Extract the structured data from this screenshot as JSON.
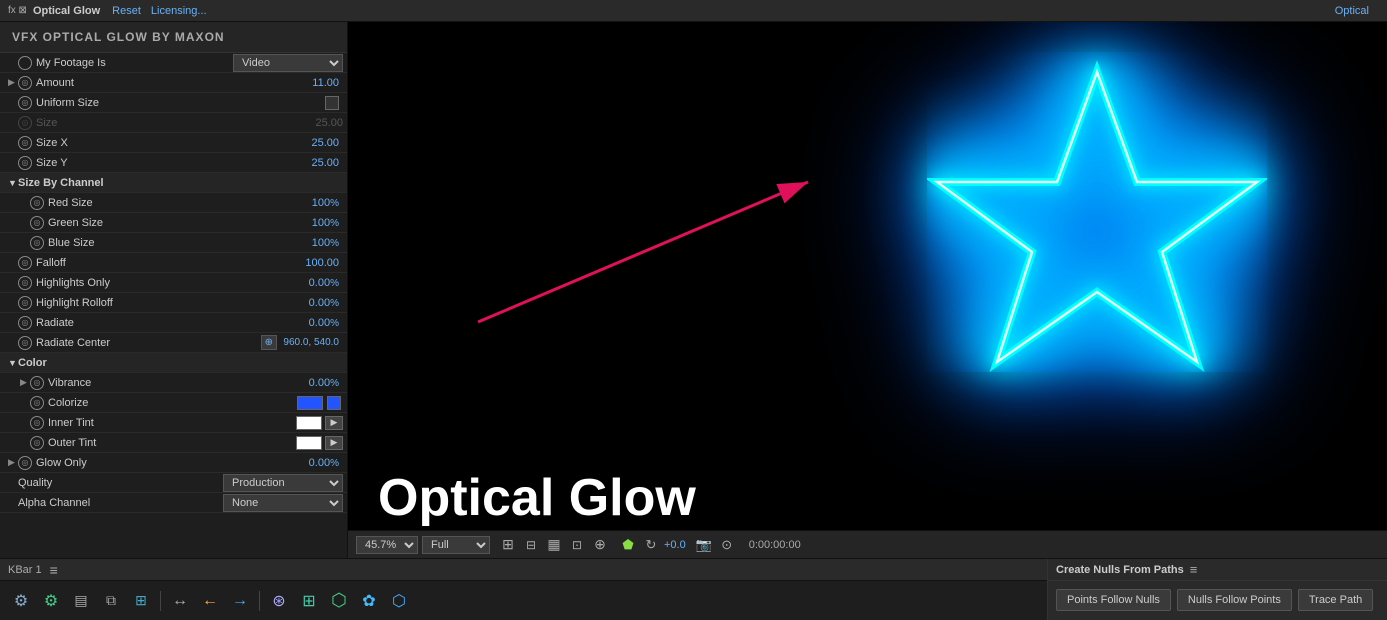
{
  "topbar": {
    "plugin_name": "Optical Glow",
    "fx_label": "fx ⊠",
    "reset_label": "Reset",
    "licensing_label": "Licensing...",
    "tab_label": "Optical"
  },
  "plugin_title": "VFX OPTICAL GLOW BY MAXON",
  "params": [
    {
      "id": "my-footage-is",
      "name": "My Footage Is",
      "type": "dropdown",
      "value": "Video",
      "expandable": false,
      "indent": 0
    },
    {
      "id": "amount",
      "name": "Amount",
      "type": "value",
      "value": "11.00",
      "expandable": true,
      "indent": 0
    },
    {
      "id": "uniform-size",
      "name": "Uniform Size",
      "type": "checkbox",
      "value": false,
      "expandable": false,
      "indent": 0
    },
    {
      "id": "size",
      "name": "Size",
      "type": "value",
      "value": "25.00",
      "disabled": true,
      "expandable": false,
      "indent": 0
    },
    {
      "id": "size-x",
      "name": "Size X",
      "type": "value",
      "value": "25.00",
      "expandable": false,
      "indent": 0
    },
    {
      "id": "size-y",
      "name": "Size Y",
      "type": "value",
      "value": "25.00",
      "expandable": false,
      "indent": 0
    },
    {
      "id": "size-by-channel",
      "name": "Size By Channel",
      "type": "group",
      "expandable": true,
      "indent": 0
    },
    {
      "id": "red-size",
      "name": "Red Size",
      "type": "value",
      "value": "100",
      "unit": "%",
      "expandable": false,
      "indent": 1
    },
    {
      "id": "green-size",
      "name": "Green Size",
      "type": "value",
      "value": "100",
      "unit": "%",
      "expandable": false,
      "indent": 1
    },
    {
      "id": "blue-size",
      "name": "Blue Size",
      "type": "value",
      "value": "100",
      "unit": "%",
      "expandable": false,
      "indent": 1
    },
    {
      "id": "falloff",
      "name": "Falloff",
      "type": "value",
      "value": "100.00",
      "expandable": false,
      "indent": 0
    },
    {
      "id": "highlights-only",
      "name": "Highlights Only",
      "type": "value",
      "value": "0.00",
      "unit": "%",
      "expandable": false,
      "indent": 0
    },
    {
      "id": "highlight-rolloff",
      "name": "Highlight Rolloff",
      "type": "value",
      "value": "0.00",
      "unit": "%",
      "expandable": false,
      "indent": 0
    },
    {
      "id": "radiate",
      "name": "Radiate",
      "type": "value",
      "value": "0.00",
      "unit": "%",
      "expandable": false,
      "indent": 0
    },
    {
      "id": "radiate-center",
      "name": "Radiate Center",
      "type": "coords",
      "value": "960.0, 540.0",
      "expandable": false,
      "indent": 0
    },
    {
      "id": "color-section",
      "name": "Color",
      "type": "section",
      "expandable": true,
      "indent": 0
    },
    {
      "id": "vibrance",
      "name": "Vibrance",
      "type": "value",
      "value": "0.00",
      "unit": "%",
      "expandable": true,
      "indent": 1
    },
    {
      "id": "colorize",
      "name": "Colorize",
      "type": "color",
      "color": "blue",
      "expandable": false,
      "indent": 1
    },
    {
      "id": "inner-tint",
      "name": "Inner Tint",
      "type": "tint",
      "expandable": false,
      "indent": 1
    },
    {
      "id": "outer-tint",
      "name": "Outer Tint",
      "type": "tint",
      "expandable": false,
      "indent": 1
    },
    {
      "id": "glow-only",
      "name": "Glow Only",
      "type": "value",
      "value": "0.00",
      "unit": "%",
      "expandable": true,
      "indent": 0
    }
  ],
  "quality": {
    "label": "Quality",
    "value": "Production"
  },
  "alpha_channel": {
    "label": "Alpha Channel",
    "value": "None"
  },
  "preview": {
    "zoom": "45.7%",
    "quality": "Full",
    "time": "0:00:00:00",
    "plus_label": "+0.0"
  },
  "kbar": {
    "label": "KBar 1",
    "menu_symbol": "≡"
  },
  "nulls_panel": {
    "title": "Create Nulls From Paths",
    "menu_symbol": "≡",
    "points_follow_nulls": "Points Follow Nulls",
    "nulls_follow_points": "Nulls Follow Points",
    "trace_path": "Trace Path"
  },
  "colors": {
    "blue_value": "#6ab0f5",
    "disabled_value": "#555555",
    "swatch_blue": "#2255ff",
    "swatch_white": "#ffffff",
    "glow_color": "#00ffff"
  }
}
